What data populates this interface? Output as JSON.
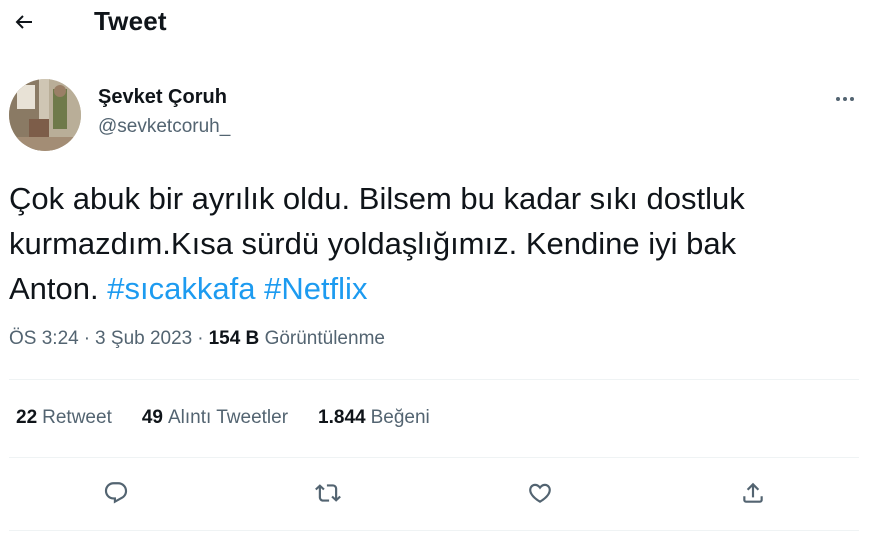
{
  "header": {
    "back_icon": "arrow-left-icon",
    "title": "Tweet"
  },
  "author": {
    "name": "Şevket Çoruh",
    "handle": "@sevketcoruh_",
    "more_icon": "more-horizontal-icon"
  },
  "tweet": {
    "line1": "Çok abuk bir ayrılık oldu. Bilsem bu kadar sıkı dostluk",
    "line2": "kurmazdım.Kısa sürdü yoldaşlığımız. Kendine iyi bak",
    "line3_prefix": "Anton.",
    "hashtag1": "#sıcakkafa",
    "hashtag2": "#Netflix"
  },
  "meta": {
    "time": "ÖS 3:24",
    "date": "3 Şub 2023",
    "views_count": "154 B",
    "views_label": "Görüntülenme"
  },
  "stats": {
    "retweets_count": "22",
    "retweets_label": "Retweet",
    "quotes_count": "49",
    "quotes_label": "Alıntı Tweetler",
    "likes_count": "1.844",
    "likes_label": "Beğeni"
  },
  "actions": {
    "reply_icon": "reply-icon",
    "retweet_icon": "retweet-icon",
    "like_icon": "heart-icon",
    "share_icon": "share-icon"
  },
  "colors": {
    "text": "#0f1419",
    "secondary": "#536471",
    "link": "#1d9bf0",
    "divider": "#eff3f4"
  }
}
